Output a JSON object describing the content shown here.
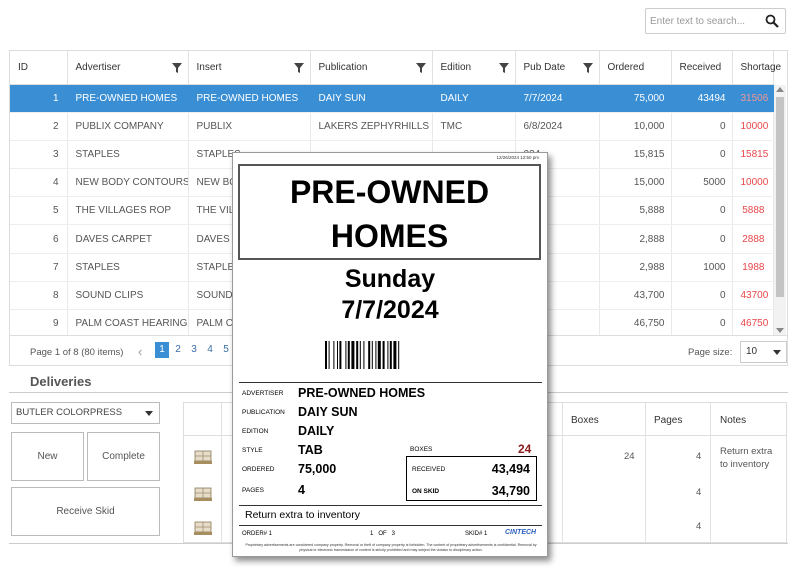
{
  "search": {
    "placeholder": "Enter text to search..."
  },
  "grid": {
    "columns": [
      "ID",
      "Advertiser",
      "Insert",
      "Publication",
      "Edition",
      "Pub Date",
      "Ordered",
      "Received",
      "Shortage"
    ],
    "rows": [
      [
        "1",
        "PRE-OWNED HOMES",
        "PRE-OWNED HOMES",
        "DAIY SUN",
        "DAILY",
        "7/7/2024",
        "75,000",
        "43494",
        "31506"
      ],
      [
        "2",
        "PUBLIX COMPANY",
        "PUBLIX",
        "LAKERS ZEPHYRHILLS",
        "TMC",
        "6/8/2024",
        "10,000",
        "0",
        "10000"
      ],
      [
        "3",
        "STAPLES",
        "STAPLES",
        "",
        "",
        "024",
        "15,815",
        "0",
        "15815"
      ],
      [
        "4",
        "NEW BODY CONTOURS",
        "NEW BO",
        "",
        "",
        "024",
        "15,000",
        "5000",
        "10000"
      ],
      [
        "5",
        "THE VILLAGES ROP",
        "THE VIL",
        "",
        "",
        "024",
        "5,888",
        "0",
        "5888"
      ],
      [
        "6",
        "DAVES CARPET",
        "DAVES",
        "",
        "",
        "024",
        "2,888",
        "0",
        "2888"
      ],
      [
        "7",
        "STAPLES",
        "STAPLES",
        "",
        "",
        "024",
        "2,988",
        "1000",
        "1988"
      ],
      [
        "8",
        "SOUND CLIPS",
        "SOUND",
        "",
        "",
        "4",
        "43,700",
        "0",
        "43700"
      ],
      [
        "9",
        "PALM COAST HEARING",
        "PALM C",
        "",
        "",
        "024",
        "46,750",
        "0",
        "46750"
      ]
    ],
    "selected_index": 0,
    "pager": {
      "info": "Page 1 of 8 (80 items)",
      "prev": "‹",
      "pages": [
        "1",
        "2",
        "3",
        "4",
        "5"
      ],
      "active_page": "1",
      "page_size_label": "Page size:",
      "page_size": "10"
    }
  },
  "deliveries": {
    "title": "Deliveries",
    "vendor": "BUTLER COLORPRESS",
    "buttons": {
      "new": "New",
      "complete": "Complete",
      "receive_skid": "Receive Skid"
    },
    "columns": {
      "boxes": "Boxes",
      "pages": "Pages",
      "notes": "Notes"
    },
    "rows": [
      {
        "boxes": "24",
        "pages": "4",
        "notes": "Return extra to inventory"
      },
      {
        "boxes": "",
        "pages": "4",
        "notes": ""
      },
      {
        "boxes": "",
        "pages": "4",
        "notes": ""
      }
    ]
  },
  "label": {
    "timestamp": "12/26/2024 12:50 pm",
    "advertiser_big_line1": "PRE-OWNED",
    "advertiser_big_line2": "HOMES",
    "day": "Sunday",
    "date": "7/7/2024",
    "fields": {
      "advertiser_key": "ADVERTISER",
      "advertiser": "PRE-OWNED HOMES",
      "publication_key": "PUBLICATION",
      "publication": "DAIY SUN",
      "edition_key": "EDITION",
      "edition": "DAILY",
      "style_key": "STYLE",
      "style": "TAB",
      "ordered_key": "ORDERED",
      "ordered": "75,000",
      "pages_key": "PAGES",
      "pages": "4",
      "boxes_key": "BOXES",
      "boxes": "24",
      "received_key": "RECEIVED",
      "received": "43,494",
      "onskid_key": "ON SKID",
      "onskid": "34,790"
    },
    "note": "Return extra to inventory",
    "order": "ORDER# 1",
    "of_text": "1   OF   3",
    "skid": "SKID# 1",
    "brand": "CINTECH",
    "legal": "Proprietary advertisements are considered company property. Removal or theft of company property is forbidden. The content of proprietary advertisements is confidential. Removal by physical or electronic transmission of content is strictly prohibited and may subject the violator to disciplinary action."
  },
  "colors": {
    "accent": "#3a8fd4",
    "shortage": "#e8464a",
    "boxes": "#8b1c1c",
    "brand": "#2b5fbf"
  }
}
